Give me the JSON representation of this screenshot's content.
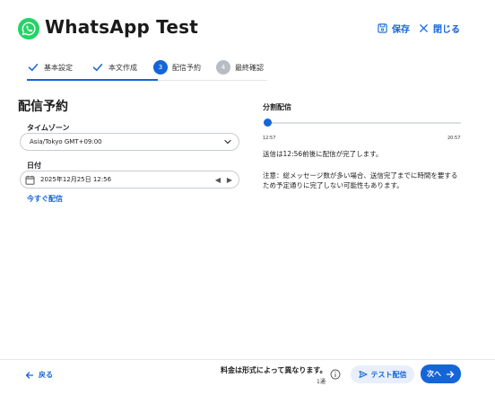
{
  "header": {
    "title": "WhatsApp Test",
    "save_label": "保存",
    "close_label": "閉じる"
  },
  "stepper": {
    "steps": [
      {
        "label": "基本設定",
        "state": "done"
      },
      {
        "label": "本文作成",
        "state": "done"
      },
      {
        "number": "3",
        "label": "配信予約",
        "state": "active"
      },
      {
        "number": "4",
        "label": "最終確認",
        "state": "pending"
      }
    ]
  },
  "schedule": {
    "title": "配信予約",
    "timezone_label": "タイムゾーン",
    "timezone_value": "Asia/Tokyo GMT+09:00",
    "date_label": "日付",
    "date_value": "2025年12月25日 12:56",
    "send_now_label": "今すぐ配信"
  },
  "split": {
    "title": "分割配信",
    "min_label": "12:57",
    "max_label": "20:57",
    "slider_position": 0,
    "info": "送信は12:56前後に配信が完了します。",
    "note": "注意：総メッセージ数が多い場合、送信完了までに時間を要するため予定通りに完了しない可能性もあります。"
  },
  "footer": {
    "back_label": "戻る",
    "price_text": "料金は形式によって異なります。",
    "price_sub": "1通",
    "test_label": "テスト配信",
    "next_label": "次へ"
  },
  "colors": {
    "accent": "#1565d8",
    "whatsapp_green": "#25d366",
    "pending_grey": "#b8bcc4"
  }
}
